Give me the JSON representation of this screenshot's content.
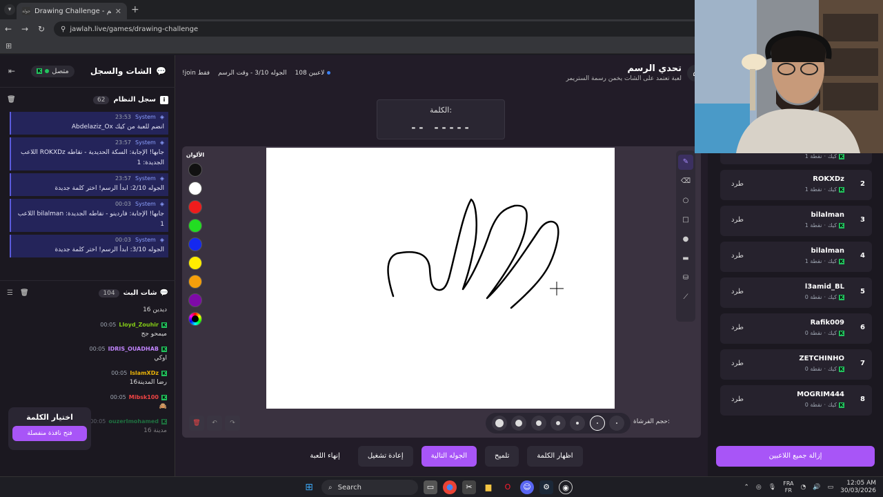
{
  "browser": {
    "tab_title": "Drawing Challenge - تحدي الرسم",
    "favicon_text": "جولة",
    "url": "jawlah.live/games/drawing-challenge"
  },
  "chat_panel": {
    "title": "الشات والسجل",
    "status": "متصل",
    "system_log": {
      "title": "سجل النظام",
      "count": "62",
      "messages": [
        {
          "time": "23:53",
          "sender": "System",
          "text": "Abdelaziz_Ox انضم للعبة من كيك"
        },
        {
          "time": "23:57",
          "sender": "System",
          "text": "اللاعب ROKXDz جابها! الإجابة: السكة الحديدية - نقاطه الجديدة: 1"
        },
        {
          "time": "23:57",
          "sender": "System",
          "text": "الجوله 2/10: ابدأ الرسم! اختر كلمة جديدة"
        },
        {
          "time": "00:03",
          "sender": "System",
          "text": "اللاعب bilalman جابها! الإجابة: فاردينو - نقاطه الجديدة: 1"
        },
        {
          "time": "00:03",
          "sender": "System",
          "text": "الجوله 3/10: ابدأ الرسم! اختر كلمة جديدة"
        }
      ]
    },
    "stream_chat": {
      "title": "شات البث",
      "count": "104",
      "messages": [
        {
          "time": "",
          "user": "",
          "user_color": "#22c55e",
          "text": "ديدين 16"
        },
        {
          "time": "00:05",
          "user": "Lloyd_Zouhir",
          "user_color": "#84cc16",
          "text": "ميمحو جج"
        },
        {
          "time": "00:05",
          "user": "IDRIS_OUADHAB",
          "user_color": "#c084fc",
          "text": "اوكي"
        },
        {
          "time": "00:05",
          "user": "IslamXDz",
          "user_color": "#eab308",
          "text": "رضا المدينة16"
        },
        {
          "time": "00:05",
          "user": "Mibsk100",
          "user_color": "#ef4444",
          "text": "🙈"
        },
        {
          "time": "00:05",
          "user": "ouzerImohamed",
          "user_color": "#22c55e",
          "text": "مدينة 16"
        }
      ]
    },
    "pick_word": {
      "title": "اختيار الكلمة",
      "button": "فتح نافذة منفصلة"
    }
  },
  "game": {
    "title": "تحدي الرسم",
    "subtitle": "لعبة تعتمد على الشات يخمن رسمة الستريمر",
    "players_online": "108 لاعبين",
    "round_info": "الجوله 3/10 - وقت الرسم",
    "join_hint": "!join فقط",
    "word_label": "الكلمة:",
    "word_mask": "-- -----",
    "colors_label": "الألوان",
    "colors": [
      "#111111",
      "#ffffff",
      "#ef1c1c",
      "#22dd22",
      "#1428f0",
      "#ffee00",
      "#f59e0b",
      "#7e0aa8",
      "multicolor"
    ],
    "brush_size_label": "حجم الفرشاة:",
    "brush_sizes": [
      12,
      10,
      8,
      6,
      4,
      2,
      2
    ],
    "selected_brush_index": 5,
    "controls": {
      "show_word": "اظهار الكلمة",
      "hint": "تلميح",
      "next_round": "الجوله التالية",
      "restart": "إعادة تشغيل",
      "end_game": "إنهاء اللعبة"
    }
  },
  "leaderboard": {
    "players": [
      {
        "rank": "2",
        "name": "ROKXDz",
        "platform": "كيك",
        "points": "1 نقطة",
        "kick": "طرد"
      },
      {
        "rank": "3",
        "name": "bilalman",
        "platform": "كيك",
        "points": "1 نقطة",
        "kick": "طرد"
      },
      {
        "rank": "4",
        "name": "bilalman",
        "platform": "كيك",
        "points": "1 نقطة",
        "kick": "طرد"
      },
      {
        "rank": "5",
        "name": "l3amid_BL",
        "platform": "كيك",
        "points": "0 نقطة",
        "kick": "طرد"
      },
      {
        "rank": "6",
        "name": "Rafik009",
        "platform": "كيك",
        "points": "0 نقطة",
        "kick": "طرد"
      },
      {
        "rank": "7",
        "name": "ZETCHINHO",
        "platform": "كيك",
        "points": "0 نقطة",
        "kick": "طرد"
      },
      {
        "rank": "8",
        "name": "MOGRIM444",
        "platform": "كيك",
        "points": "0 نقطة",
        "kick": "طرد"
      }
    ],
    "partial_top": {
      "platform": "كيك",
      "points": "1 نقطة"
    },
    "remove_all": "إزالة جميع اللاعبين"
  },
  "taskbar": {
    "search": "Search",
    "lang_top": "FRA",
    "lang_bottom": "FR",
    "time": "12:05 AM",
    "date": "30/03/2026"
  }
}
